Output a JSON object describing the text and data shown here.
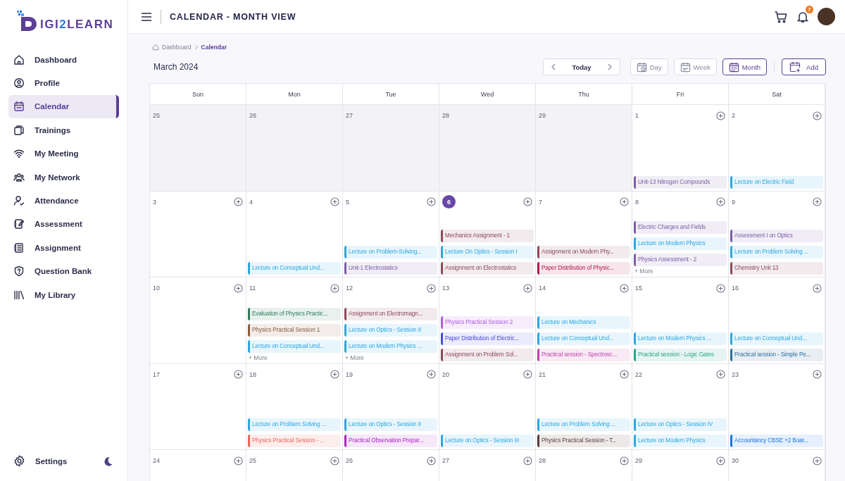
{
  "logo": {
    "parts": [
      {
        "text": "IGI",
        "accent": false
      },
      {
        "text": "2",
        "accent": true
      },
      {
        "text": "LEARN",
        "accent": false
      }
    ]
  },
  "sidebar": {
    "items": [
      {
        "label": "Dashboard",
        "selected": false
      },
      {
        "label": "Profile",
        "selected": false
      },
      {
        "label": "Calendar",
        "selected": true
      },
      {
        "label": "Trainings",
        "selected": false
      },
      {
        "label": "My Meeting",
        "selected": false
      },
      {
        "label": "My Network",
        "selected": false
      },
      {
        "label": "Attendance",
        "selected": false
      },
      {
        "label": "Assessment",
        "selected": false
      },
      {
        "label": "Assignment",
        "selected": false
      },
      {
        "label": "Question Bank",
        "selected": false
      },
      {
        "label": "My Library",
        "selected": false
      }
    ],
    "settings": "Settings"
  },
  "header": {
    "title": "CALENDAR - MONTH VIEW",
    "notifications": "7"
  },
  "breadcrumb": {
    "items": [
      "Dashboard",
      "Calendar"
    ]
  },
  "toolbar": {
    "month": "March 2024",
    "today": "Today",
    "views": [
      {
        "label": "Day",
        "selected": false
      },
      {
        "label": "Week",
        "selected": false
      },
      {
        "label": "Month",
        "selected": true
      }
    ],
    "add": "Add"
  },
  "calendar": {
    "weekdays": [
      "Sun",
      "Mon",
      "Tue",
      "Wed",
      "Thu",
      "Fri",
      "Sat"
    ],
    "weeks": [
      [
        {
          "day": "25",
          "outside": true,
          "today": false
        },
        {
          "day": "26",
          "outside": true,
          "today": false
        },
        {
          "day": "27",
          "outside": true,
          "today": false
        },
        {
          "day": "28",
          "outside": true,
          "today": false
        },
        {
          "day": "29",
          "outside": true,
          "today": false
        },
        {
          "day": "1",
          "outside": false,
          "today": false,
          "events": [
            {
              "title": "Unit-13 Nitrogen Compounds",
              "color": "#7b5ea7"
            }
          ]
        },
        {
          "day": "2",
          "outside": false,
          "today": false,
          "events": [
            {
              "title": "Lecture on Electric Field",
              "color": "#29a8e0"
            }
          ]
        }
      ],
      [
        {
          "day": "3",
          "outside": false,
          "today": false
        },
        {
          "day": "4",
          "outside": false,
          "today": false,
          "events": [
            {
              "title": "Lecture on Conceptual Und...",
              "color": "#29a8e0"
            }
          ]
        },
        {
          "day": "5",
          "outside": false,
          "today": false,
          "events": [
            {
              "title": "Lecture on Problem-Solving...",
              "color": "#29a8e0"
            },
            {
              "title": "Unit-1 Electrostatics",
              "color": "#7b5ea7"
            }
          ]
        },
        {
          "day": "6",
          "outside": false,
          "today": true,
          "events": [
            {
              "title": "Mechanics Assignment - 1",
              "color": "#8b4a5a"
            },
            {
              "title": "Lecture On Optics - Session I",
              "color": "#29a8e0"
            },
            {
              "title": "Assignment on Electrostatics",
              "color": "#8b4a5a"
            }
          ]
        },
        {
          "day": "7",
          "outside": false,
          "today": false,
          "events": [
            {
              "title": "Assignment on Modern Phy...",
              "color": "#8b4a5a"
            },
            {
              "title": "Paper Distribution of Physic...",
              "color": "#b0174f"
            }
          ]
        },
        {
          "day": "8",
          "outside": false,
          "today": false,
          "events": [
            {
              "title": "Electric Charges and Fields",
              "color": "#7b5ea7"
            },
            {
              "title": "Lecture on Modern Physics",
              "color": "#29a8e0"
            },
            {
              "title": "Physics Assessment - 2",
              "color": "#7b5ea7"
            }
          ],
          "more": "+ More"
        },
        {
          "day": "9",
          "outside": false,
          "today": false,
          "events": [
            {
              "title": "Assessment I on Optics",
              "color": "#7b5ea7"
            },
            {
              "title": "Lecture on Problem Solving ...",
              "color": "#29a8e0"
            },
            {
              "title": "Chemistry Unit 13",
              "color": "#8b4a5a"
            }
          ]
        }
      ],
      [
        {
          "day": "10",
          "outside": false,
          "today": false
        },
        {
          "day": "11",
          "outside": false,
          "today": false,
          "events": [
            {
              "title": "Evaluation of Physics Practic...",
              "color": "#2e7d5b"
            },
            {
              "title": "Physics Practical Session 1",
              "color": "#8b5a3c"
            },
            {
              "title": "Lecture on Conceptual Und...",
              "color": "#29a8e0"
            }
          ],
          "more": "+ More"
        },
        {
          "day": "12",
          "outside": false,
          "today": false,
          "events": [
            {
              "title": "Assignment on Electromagn...",
              "color": "#8b4a5a"
            },
            {
              "title": "Lecture on Optics - Session II",
              "color": "#29a8e0"
            },
            {
              "title": "Lecture on Modern Physics ...",
              "color": "#29a8e0"
            }
          ],
          "more": "+ More"
        },
        {
          "day": "13",
          "outside": false,
          "today": false,
          "events": [
            {
              "title": "Physics Practical Session 2",
              "color": "#b05be0"
            },
            {
              "title": "Paper Distribution of Electric...",
              "color": "#4a4ae0"
            },
            {
              "title": "Assignment on Problem Sol...",
              "color": "#8b4a5a"
            }
          ]
        },
        {
          "day": "14",
          "outside": false,
          "today": false,
          "events": [
            {
              "title": "Lecture on Mechanics",
              "color": "#29a8e0"
            },
            {
              "title": "Lecture on Conceptual Und...",
              "color": "#29a8e0"
            },
            {
              "title": "Practical session - Spectrosc...",
              "color": "#c040a8"
            }
          ]
        },
        {
          "day": "15",
          "outside": false,
          "today": false,
          "events": [
            {
              "title": "Lecture on Modern Physics ...",
              "color": "#29a8e0"
            },
            {
              "title": "Practical session - Logic Gates",
              "color": "#26a68a"
            }
          ]
        },
        {
          "day": "16",
          "outside": false,
          "today": false,
          "events": [
            {
              "title": "Lecture on Conceptual Und...",
              "color": "#29a8e0"
            },
            {
              "title": "Practical session - Simple Pe...",
              "color": "#2c6e9b"
            }
          ]
        }
      ],
      [
        {
          "day": "17",
          "outside": false,
          "today": false
        },
        {
          "day": "18",
          "outside": false,
          "today": false,
          "events": [
            {
              "title": "Lecture on Problem Solving ...",
              "color": "#29a8e0"
            },
            {
              "title": "Physics Practical Session - ...",
              "color": "#e8675a"
            }
          ]
        },
        {
          "day": "19",
          "outside": false,
          "today": false,
          "events": [
            {
              "title": "Lecture on Optics - Session II",
              "color": "#29a8e0"
            },
            {
              "title": "Practical Observation Prepar...",
              "color": "#b020c8"
            }
          ]
        },
        {
          "day": "20",
          "outside": false,
          "today": false,
          "events": [
            {
              "title": "Lecture on Optics - Session III",
              "color": "#29a8e0"
            }
          ]
        },
        {
          "day": "21",
          "outside": false,
          "today": false,
          "events": [
            {
              "title": "Lecture on Problem Solving ...",
              "color": "#29a8e0"
            },
            {
              "title": "Physics Practical Session - T...",
              "color": "#5a3a3a"
            }
          ]
        },
        {
          "day": "22",
          "outside": false,
          "today": false,
          "events": [
            {
              "title": "Lecture on Optics - Session IV",
              "color": "#29a8e0"
            },
            {
              "title": "Lecture on Modern Physics",
              "color": "#29a8e0"
            }
          ]
        },
        {
          "day": "23",
          "outside": false,
          "today": false,
          "events": [
            {
              "title": "Accountancy CBSE +2 Boar...",
              "color": "#1a73e8"
            }
          ]
        }
      ],
      [
        {
          "day": "24",
          "outside": false,
          "today": false
        },
        {
          "day": "25",
          "outside": false,
          "today": false
        },
        {
          "day": "26",
          "outside": false,
          "today": false
        },
        {
          "day": "27",
          "outside": false,
          "today": false
        },
        {
          "day": "28",
          "outside": false,
          "today": false
        },
        {
          "day": "29",
          "outside": false,
          "today": false
        },
        {
          "day": "30",
          "outside": false,
          "today": false
        }
      ]
    ]
  }
}
